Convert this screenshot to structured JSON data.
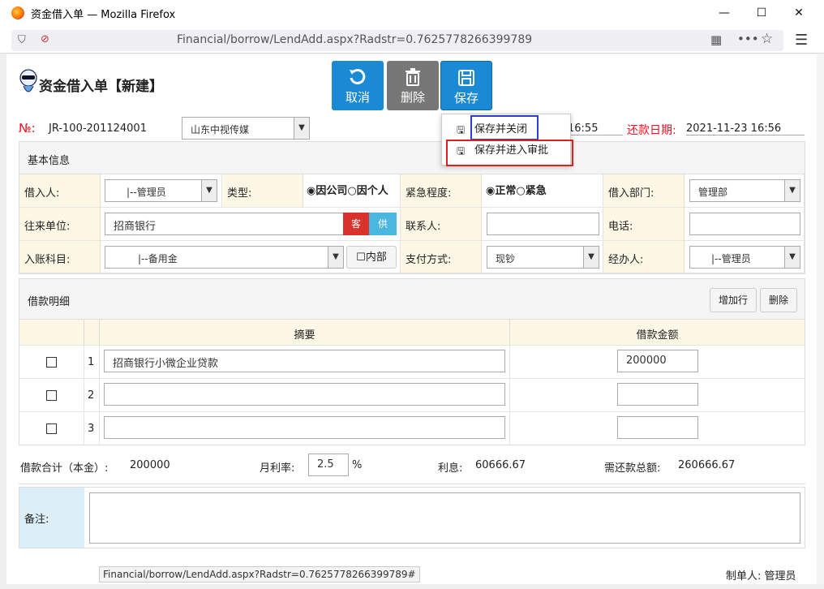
{
  "window": {
    "title": "资金借入单 — Mozilla Firefox",
    "url": "Financial/borrow/LendAdd.aspx?Radstr=0.7625778266399789"
  },
  "toolbar": {
    "cancel": "取消",
    "delete": "删除",
    "save": "保存"
  },
  "page_title": "资金借入单【新建】",
  "header": {
    "no_label": "№:",
    "no_value": "JR-100-201124001",
    "company": "山东中视传媒",
    "time_partial": "16:55",
    "repay_label": "还款日期:",
    "repay_value": "2021-11-23 16:56"
  },
  "save_menu": {
    "item1": "保存并关闭",
    "item2": "保存并进入审批"
  },
  "basic": {
    "head": "基本信息",
    "borrower_label": "借入人:",
    "borrower_value": "|--管理员",
    "type_label": "类型:",
    "type_opt1": "因公司",
    "type_opt2": "因个人",
    "urgency_label": "紧急程度:",
    "urgency_opt1": "正常",
    "urgency_opt2": "紧急",
    "dept_label": "借入部门:",
    "dept_value": "管理部",
    "unit_label": "往来单位:",
    "unit_value": "招商银行",
    "unit_btn1": "客",
    "unit_btn2": "供",
    "contact_label": "联系人:",
    "phone_label": "电话:",
    "account_label": "入账科目:",
    "account_value": "|--备用金",
    "internal_label": "内部",
    "pay_label": "支付方式:",
    "pay_value": "现钞",
    "handler_label": "经办人:",
    "handler_value": "|--管理员"
  },
  "detail": {
    "head": "借款明细",
    "add_row": "增加行",
    "delete": "删除",
    "col_summary": "摘要",
    "col_amount": "借款金额",
    "rows": [
      {
        "no": "1",
        "summary": "招商银行小微企业贷款",
        "amount": "200000"
      },
      {
        "no": "2",
        "summary": "",
        "amount": ""
      },
      {
        "no": "3",
        "summary": "",
        "amount": ""
      }
    ]
  },
  "totals": {
    "principal_label": "借款合计（本金）:",
    "principal_value": "200000",
    "rate_label": "月利率:",
    "rate_value": "2.5",
    "rate_unit": "%",
    "interest_label": "利息:",
    "interest_value": "60666.67",
    "total_label": "需还款总额:",
    "total_value": "260666.67"
  },
  "remarks_label": "备注:",
  "creator": "制单人: 管理员",
  "status_url": "Financial/borrow/LendAdd.aspx?Radstr=0.7625778266399789#",
  "colors": {
    "accent": "#1a8ad4",
    "red": "#e12",
    "label_bg": "#fdf8e6"
  }
}
